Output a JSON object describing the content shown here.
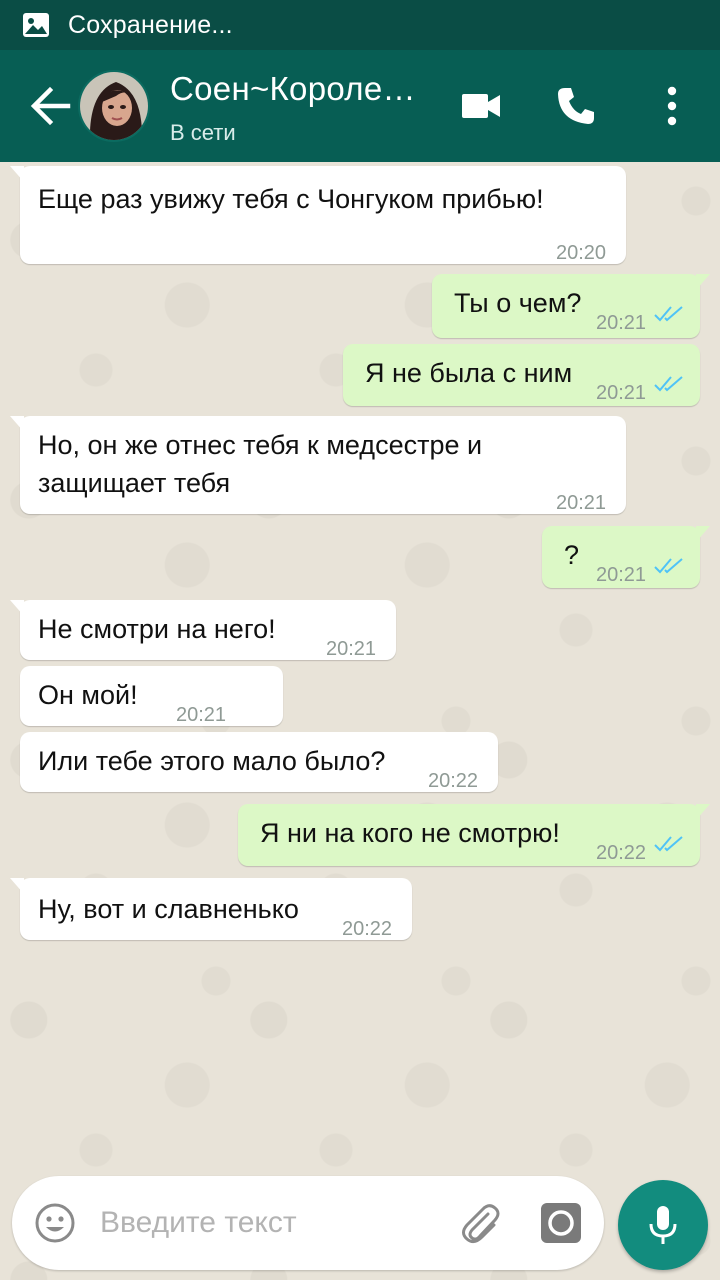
{
  "status_bar": {
    "icon": "image-icon",
    "text": "Сохранение..."
  },
  "header": {
    "back_icon": "arrow-back-icon",
    "contact_name": "Соен~Королева...",
    "contact_status": "В сети",
    "video_icon": "videocam-icon",
    "call_icon": "phone-icon",
    "menu_icon": "more-vert-icon"
  },
  "messages": [
    {
      "direction": "in",
      "text": "Еще раз увижу тебя с Чонгуком прибью!",
      "time": "20:20"
    },
    {
      "direction": "out",
      "text": "Ты о чем?",
      "time": "20:21",
      "status": "read"
    },
    {
      "direction": "out",
      "text": "Я не была с ним",
      "time": "20:21",
      "status": "read"
    },
    {
      "direction": "in",
      "text": "Но, он же отнес тебя к медсестре и\nзащищает тебя",
      "time": "20:21"
    },
    {
      "direction": "out",
      "text": "?",
      "time": "20:21",
      "status": "read"
    },
    {
      "direction": "in",
      "text": "Не смотри на него!",
      "time": "20:21"
    },
    {
      "direction": "in",
      "text": "Он мой!",
      "time": "20:21"
    },
    {
      "direction": "in",
      "text": "Или тебе этого мало было?",
      "time": "20:22"
    },
    {
      "direction": "out",
      "text": "Я ни на кого не смотрю!",
      "time": "20:22",
      "status": "read"
    },
    {
      "direction": "in",
      "text": "Ну, вот и славненько",
      "time": "20:22"
    }
  ],
  "input_bar": {
    "emoji_icon": "emoji-icon",
    "placeholder": "Введите текст",
    "attach_icon": "paperclip-icon",
    "camera_icon": "camera-icon",
    "mic_icon": "mic-icon"
  },
  "colors": {
    "header": "#075e54",
    "status_bar": "#0a4d45",
    "outgoing_bubble": "#dcf8c6",
    "incoming_bubble": "#ffffff",
    "read_ticks": "#4fc3f7",
    "mic_button": "#128c7e"
  }
}
